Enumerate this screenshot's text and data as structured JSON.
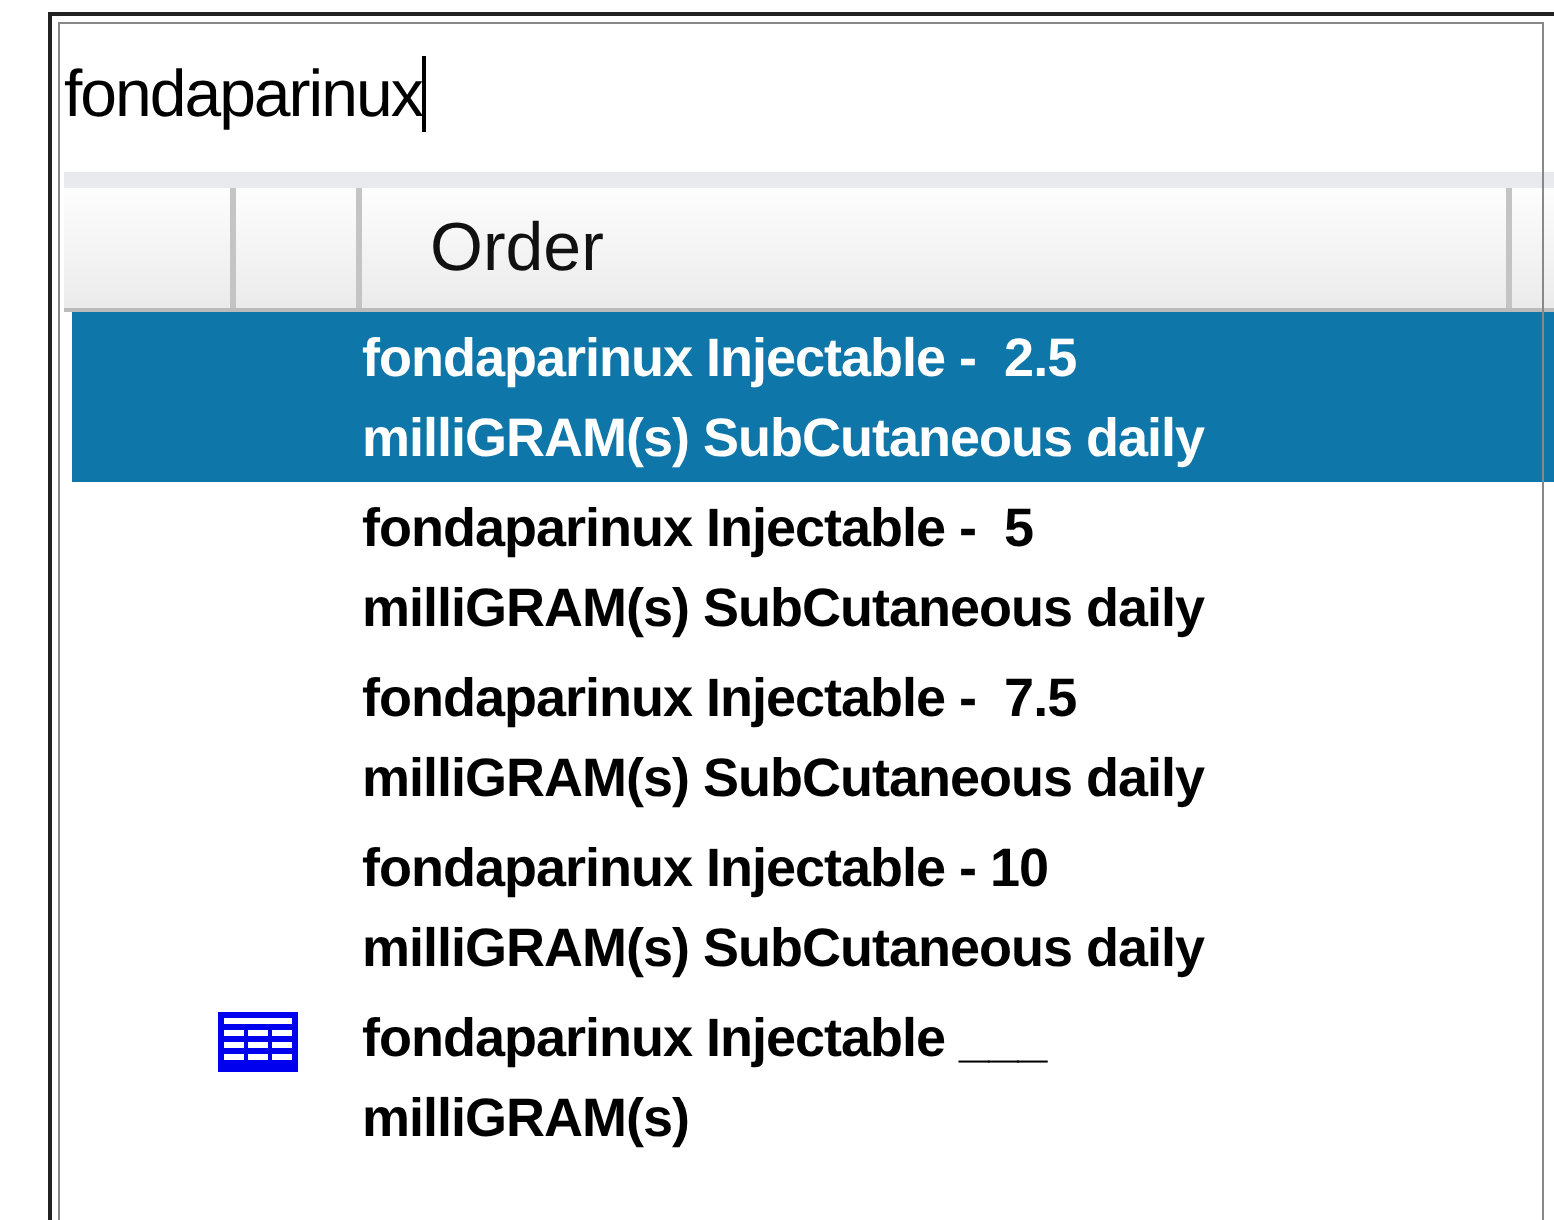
{
  "search": {
    "value": "fondaparinux"
  },
  "columns": [
    {},
    {},
    {
      "label": "Order"
    },
    {}
  ],
  "rows": [
    {
      "kind": "order",
      "selected": true,
      "lines": [
        "fondaparinux Injectable -  2.5",
        "milliGRAM(s) SubCutaneous daily"
      ]
    },
    {
      "kind": "order",
      "selected": false,
      "lines": [
        "fondaparinux Injectable -  5",
        "milliGRAM(s) SubCutaneous daily"
      ]
    },
    {
      "kind": "order",
      "selected": false,
      "lines": [
        "fondaparinux Injectable -  7.5",
        "milliGRAM(s) SubCutaneous daily"
      ]
    },
    {
      "kind": "order",
      "selected": false,
      "lines": [
        "fondaparinux Injectable - 10",
        "milliGRAM(s) SubCutaneous daily"
      ]
    },
    {
      "kind": "template",
      "selected": false,
      "lines": [
        "fondaparinux Injectable ___",
        "milliGRAM(s)"
      ]
    }
  ]
}
